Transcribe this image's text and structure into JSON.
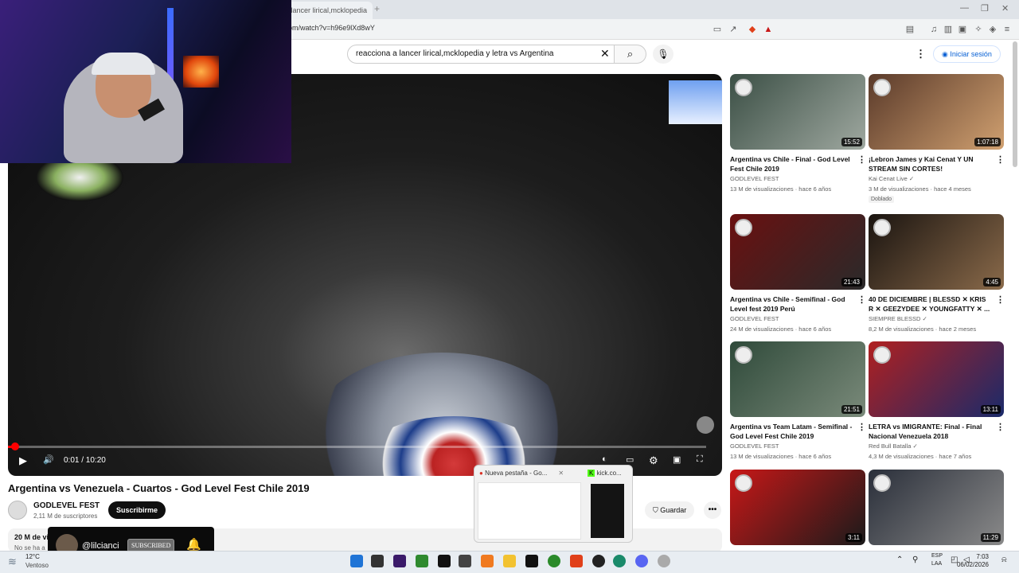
{
  "browser": {
    "tab_title": "a lancer lirical,mcklopedia",
    "new_tab": "+",
    "url": "om/watch?v=h96e9lXd8wY",
    "window_controls": [
      "—",
      "❐",
      "✕"
    ]
  },
  "search": {
    "query": "reacciona a lancer lirical,mcklopedia y letra vs Argentina",
    "clear": "✕",
    "search_icon": "⌕",
    "mic_icon": "🎙"
  },
  "header": {
    "menu": "⋮",
    "signin": "Iniciar sesión"
  },
  "player": {
    "time": "0:01 / 10:20",
    "progress_percent": 0.2,
    "play": "▶",
    "volume": "🔊",
    "settings": "⚙",
    "fullscreen": "⛶"
  },
  "video": {
    "title": "Argentina vs Venezuela - Cuartos - God Level Fest Chile 2019",
    "channel": "GODLEVEL FEST",
    "subscribers": "2,11 M de suscriptores",
    "subscribe": "Suscribirme",
    "save": "Guardar",
    "more": "•••",
    "views_partial": "20 M de vis",
    "desc_partial": "No se ha a"
  },
  "overlay": {
    "handle": "@lilcianci",
    "subscribed": "SUBSCRIBED",
    "bell": "🔔"
  },
  "taskbar_preview": {
    "item1": "Nueva pestaña - Go...",
    "item2": "kick.co..."
  },
  "sidebar": [
    {
      "title": "Argentina vs Chile - Final - God Level Fest Chile 2019",
      "channel": "GODLEVEL FEST",
      "meta": "13 M de visualizaciones · hace 6 años",
      "duration": "15:52",
      "badge": "",
      "colors": [
        "#3b4f45",
        "#9fa8a0"
      ]
    },
    {
      "title": "¡Lebron James y Kai Cenat Y UN STREAM SIN CORTES!",
      "channel": "Kai Cenat Live ✓",
      "meta": "3 M de visualizaciones · hace 4 meses",
      "duration": "1:07:18",
      "badge": "Doblado",
      "colors": [
        "#5a3a2a",
        "#d0a070"
      ]
    },
    {
      "title": "Argentina vs Chile - Semifinal - God Level fest 2019 Perú",
      "channel": "GODLEVEL FEST",
      "meta": "24 M de visualizaciones · hace 6 años",
      "duration": "21:43",
      "badge": "",
      "colors": [
        "#6a1010",
        "#2a2a2a"
      ]
    },
    {
      "title": "40 DE DICIEMBRE | BLESSD ✕ KRIS R ✕ GEEZYDEE ✕ YOUNGFATTY ✕ ...",
      "channel": "SIEMPRE BLESSD ✓",
      "meta": "8,2 M de visualizaciones · hace 2 meses",
      "duration": "4:45",
      "badge": "",
      "colors": [
        "#1a1410",
        "#8a6a4a"
      ]
    },
    {
      "title": "Argentina vs Team Latam - Semifinal - God Level Fest Chile 2019",
      "channel": "GODLEVEL FEST",
      "meta": "13 M de visualizaciones · hace 6 años",
      "duration": "21:51",
      "badge": "",
      "colors": [
        "#2f4a3a",
        "#7a8a7a"
      ]
    },
    {
      "title": "LETRA vs IMIGRANTE: Final - Final Nacional Venezuela 2018",
      "channel": "Red Bull Batalla ✓",
      "meta": "4,3 M de visualizaciones · hace 7 años",
      "duration": "13:11",
      "badge": "",
      "colors": [
        "#b02020",
        "#1a2a6a"
      ]
    },
    {
      "title": "",
      "channel": "",
      "meta": "",
      "duration": "3:11",
      "badge": "",
      "colors": [
        "#c81818",
        "#1a1a1a"
      ]
    },
    {
      "title": "",
      "channel": "",
      "meta": "",
      "duration": "11:29",
      "badge": "",
      "colors": [
        "#2a2f3a",
        "#8a8a8a"
      ]
    }
  ],
  "weather": {
    "temp": "12°C",
    "condition": "Ventoso"
  },
  "system": {
    "lang1": "ESP",
    "lang2": "LAA",
    "time": "7:03",
    "date": "06/02/2026"
  },
  "colors": {
    "accent_red": "#ff0000",
    "link_blue": "#065fd4"
  }
}
